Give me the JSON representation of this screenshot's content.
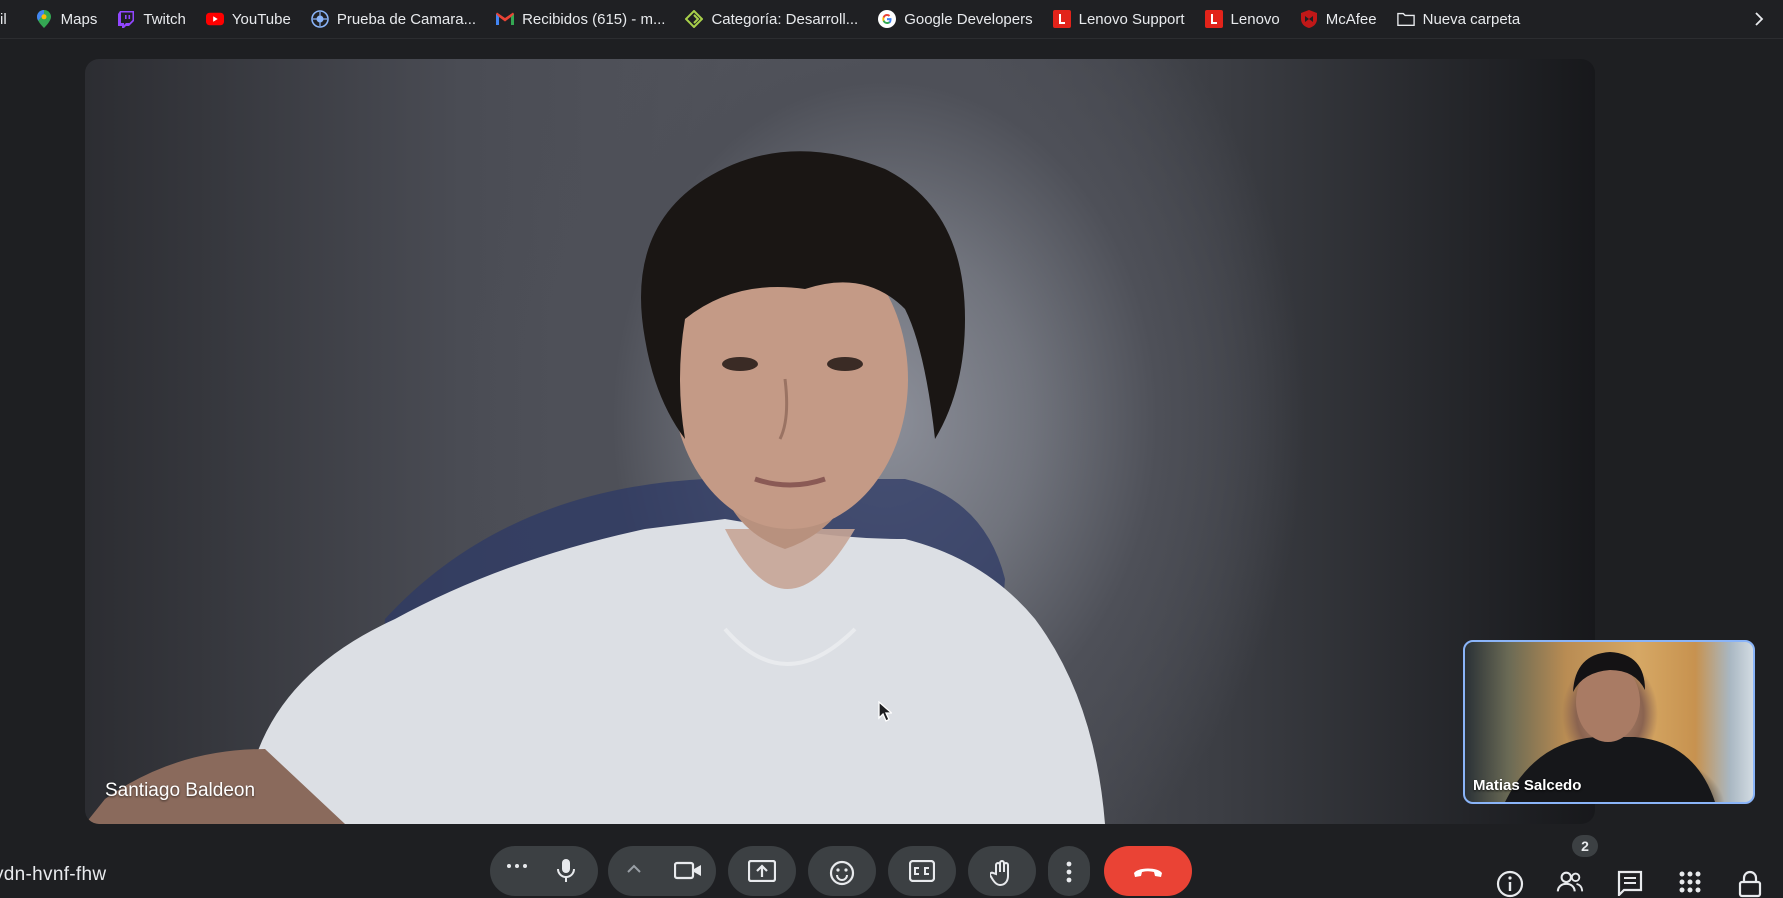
{
  "bookmarks_bar": {
    "items": [
      {
        "label": "il",
        "icon": "truncated-bookmark"
      },
      {
        "label": "Maps",
        "icon": "maps-pin-icon"
      },
      {
        "label": "Twitch",
        "icon": "twitch-icon"
      },
      {
        "label": "YouTube",
        "icon": "youtube-icon"
      },
      {
        "label": "Prueba de Camara...",
        "icon": "webcam-test-icon"
      },
      {
        "label": "Recibidos (615) - m...",
        "icon": "gmail-icon"
      },
      {
        "label": "Categoría: Desarroll...",
        "icon": "category-icon"
      },
      {
        "label": "Google Developers",
        "icon": "google-icon"
      },
      {
        "label": "Lenovo Support",
        "icon": "lenovo-icon"
      },
      {
        "label": "Lenovo",
        "icon": "lenovo-icon"
      },
      {
        "label": "McAfee",
        "icon": "mcafee-shield-icon"
      },
      {
        "label": "Nueva carpeta",
        "icon": "folder-icon"
      }
    ],
    "overflow_icon": "chevron-right-icon"
  },
  "meeting": {
    "main_participant": {
      "name": "Santiago Baldeon"
    },
    "self_view": {
      "name": "Matias Salcedo"
    },
    "meeting_code": "ydn-hvnf-fhw",
    "participants_count": "2"
  },
  "controls": {
    "buttons": [
      {
        "name": "more-options-button",
        "icon": "ellipsis-icon"
      },
      {
        "name": "microphone-button",
        "icon": "microphone-icon"
      },
      {
        "name": "camera-button",
        "icon": "camera-icon"
      },
      {
        "name": "present-screen-button",
        "icon": "present-icon"
      },
      {
        "name": "reactions-button",
        "icon": "emoji-icon"
      },
      {
        "name": "captions-button",
        "icon": "captions-icon"
      },
      {
        "name": "raise-hand-button",
        "icon": "hand-icon"
      },
      {
        "name": "more-actions-button",
        "icon": "vertical-dots-icon"
      },
      {
        "name": "leave-call-button",
        "icon": "phone-hangup-icon"
      }
    ],
    "right_icons": [
      "info-icon",
      "people-icon",
      "chat-icon",
      "activities-icon",
      "host-controls-icon"
    ]
  },
  "colors": {
    "background": "#1e1f22",
    "bookmarks_bar": "#1f2023",
    "control_button": "#3c4043",
    "end_call": "#ea4335",
    "self_view_border": "#8ab4f8"
  }
}
